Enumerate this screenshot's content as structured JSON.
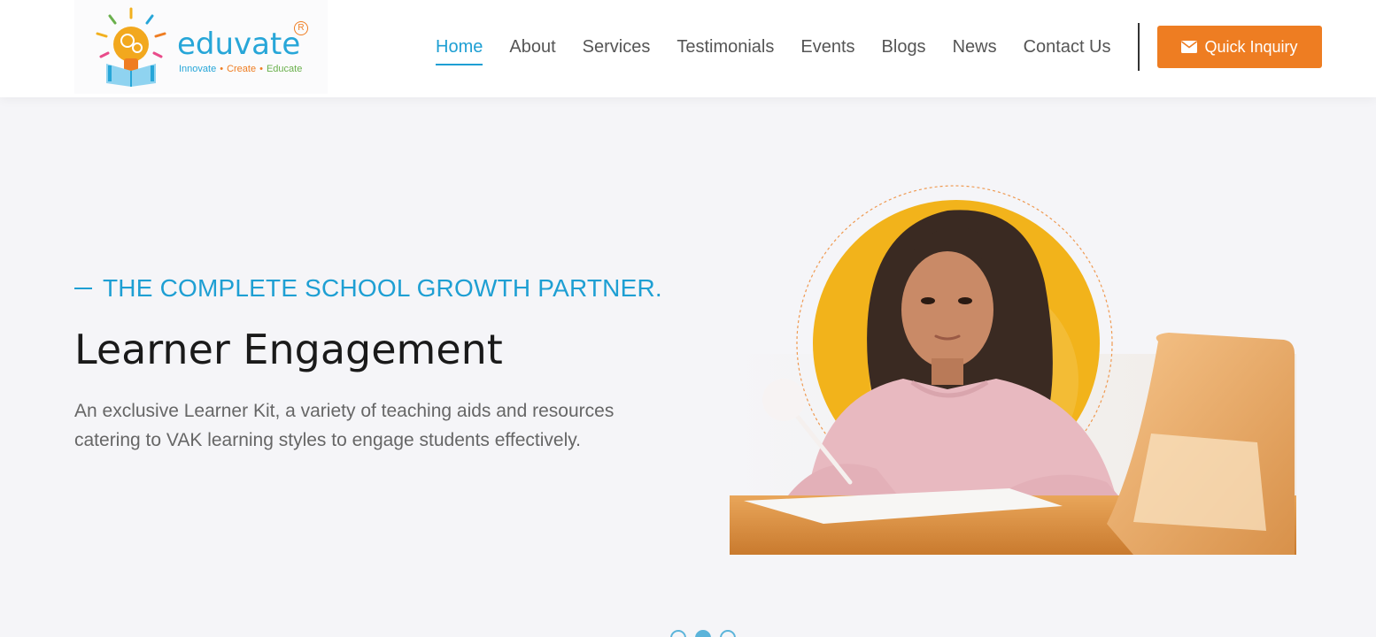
{
  "brand": {
    "name": "eduvate",
    "registered_mark": "R",
    "tagline": [
      "Innovate",
      "Create",
      "Educate"
    ],
    "tagline_separator": "•",
    "colors": {
      "blue": "#27a6d8",
      "orange": "#ef7d22",
      "green": "#6ab04c"
    }
  },
  "nav": {
    "items": [
      {
        "label": "Home",
        "active": true
      },
      {
        "label": "About"
      },
      {
        "label": "Services"
      },
      {
        "label": "Testimonials"
      },
      {
        "label": "Events"
      },
      {
        "label": "Blogs"
      },
      {
        "label": "News"
      },
      {
        "label": "Contact Us"
      }
    ],
    "cta": {
      "label": "Quick Inquiry",
      "icon": "envelope-icon",
      "color": "#ee7d22"
    }
  },
  "hero": {
    "kicker": "THE COMPLETE SCHOOL GROWTH PARTNER.",
    "title": "Learner Engagement",
    "description": "An exclusive Learner Kit, a variety of teaching aids and resources catering to VAK learning styles to engage students effectively.",
    "accent_color": "#1e9fd3"
  },
  "carousel": {
    "slide_count": 3,
    "active_index": 1
  }
}
